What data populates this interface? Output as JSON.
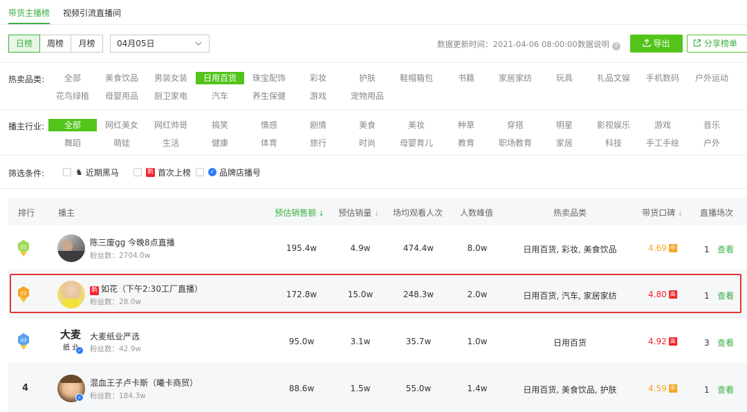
{
  "tabs": [
    {
      "label": "带货主播榜",
      "active": true
    },
    {
      "label": "视频引流直播间",
      "active": false
    }
  ],
  "period": [
    "日榜",
    "周榜",
    "月榜"
  ],
  "date": "04月05日",
  "update_time": "数据更新时间：2021-04-06 08:00:00",
  "data_desc": "数据说明",
  "export_label": "导出",
  "share_label": "分享榜单",
  "hot_category": {
    "label": "热卖品类:",
    "row1": [
      "全部",
      "美食饮品",
      "男装女装",
      "日用百货",
      "珠宝配饰",
      "彩妆",
      "护肤",
      "鞋帽箱包",
      "书籍",
      "家居家纺",
      "玩具",
      "礼品文娱",
      "手机数码",
      "户外运动"
    ],
    "row2": [
      "花鸟绿植",
      "母婴用品",
      "厨卫家电",
      "汽车",
      "养生保健",
      "游戏",
      "宠物用品"
    ],
    "active": "日用百货"
  },
  "industry": {
    "label": "播主行业:",
    "row1": [
      "全部",
      "网红美女",
      "网红帅哥",
      "搞笑",
      "情感",
      "剧情",
      "美食",
      "美妆",
      "种草",
      "穿搭",
      "明星",
      "影视娱乐",
      "游戏",
      "音乐"
    ],
    "row2": [
      "舞蹈",
      "萌娃",
      "生活",
      "健康",
      "体育",
      "旅行",
      "时尚",
      "母婴育儿",
      "教育",
      "职场教育",
      "家居",
      "科技",
      "手工手绘",
      "户外"
    ],
    "active": "全部"
  },
  "filters": {
    "label": "筛选条件:",
    "items": [
      "近期黑马",
      "首次上榜",
      "品牌店播号"
    ],
    "new_badge": "新"
  },
  "table": {
    "headers": {
      "rank": "排行",
      "host": "播主",
      "est_sales": "预估销售额",
      "est_volume": "预估销量",
      "avg_viewers": "场均观看人次",
      "peak": "人数峰值",
      "hot_cat": "热卖品类",
      "rating": "带货口碑",
      "sessions": "直播场次"
    },
    "rows": [
      {
        "rank": "01",
        "name": "陈三废gg 今晚8点直播",
        "fans": "粉丝数：2704.0w",
        "sales": "195.4w",
        "volume": "4.9w",
        "viewers": "474.4w",
        "peak": "8.0w",
        "cat": "日用百货, 彩妆, 美食饮品",
        "rating": "4.69",
        "rating_badge": "中",
        "sessions": "1",
        "view": "查看"
      },
      {
        "rank": "02",
        "name": "如花（下午2:30工厂直播）",
        "name_badge": "新",
        "fans": "粉丝数：28.0w",
        "sales": "172.8w",
        "volume": "15.0w",
        "viewers": "248.3w",
        "peak": "2.0w",
        "cat": "日用百货, 汽车, 家居家纺",
        "rating": "4.80",
        "rating_badge": "高",
        "sessions": "1",
        "view": "查看"
      },
      {
        "rank": "03",
        "name": "大麦纸业严选",
        "fans": "粉丝数：42.9w",
        "avatar_text": "大麦\n纸业",
        "sales": "95.0w",
        "volume": "3.1w",
        "viewers": "35.7w",
        "peak": "1.0w",
        "cat": "日用百货",
        "rating": "4.92",
        "rating_badge": "高",
        "sessions": "3",
        "view": "查看"
      },
      {
        "rank": "4",
        "name": "混血王子卢卡斯（曦卡商贸）",
        "fans": "粉丝数：184.3w",
        "sales": "88.6w",
        "volume": "1.5w",
        "viewers": "55.0w",
        "peak": "1.4w",
        "cat": "日用百货, 美食饮品, 护肤",
        "rating": "4.59",
        "rating_badge": "中",
        "sessions": "1",
        "view": "查看"
      }
    ]
  },
  "colors": {
    "accent": "#52c41a",
    "highlight_border": "#e23636",
    "rating_mid": "#f5a623",
    "rating_high": "#f5222d"
  }
}
